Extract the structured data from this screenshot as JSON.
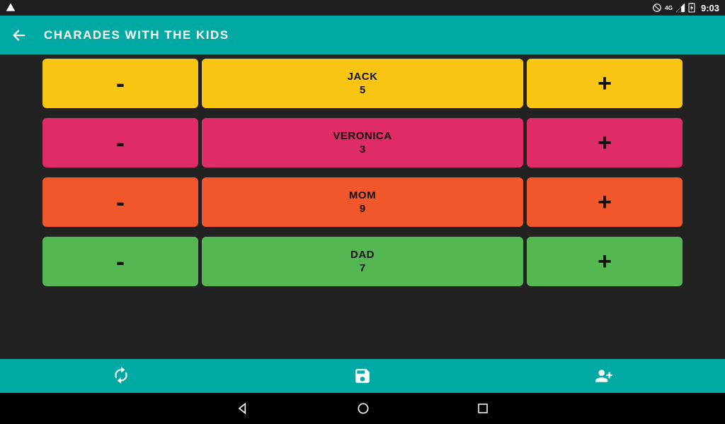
{
  "status": {
    "network_text": "4G",
    "time": "9:03"
  },
  "header": {
    "title": "CHARADES WITH THE KIDS"
  },
  "players": [
    {
      "name": "JACK",
      "score": "5",
      "color": "c-yellow"
    },
    {
      "name": "VERONICA",
      "score": "3",
      "color": "c-pink"
    },
    {
      "name": "MOM",
      "score": "9",
      "color": "c-orange"
    },
    {
      "name": "DAD",
      "score": "7",
      "color": "c-green"
    }
  ],
  "actions": {
    "reset": "reset",
    "save": "save",
    "add_player": "add_player"
  },
  "nav": {
    "back": "back",
    "home": "home",
    "recent": "recent"
  }
}
